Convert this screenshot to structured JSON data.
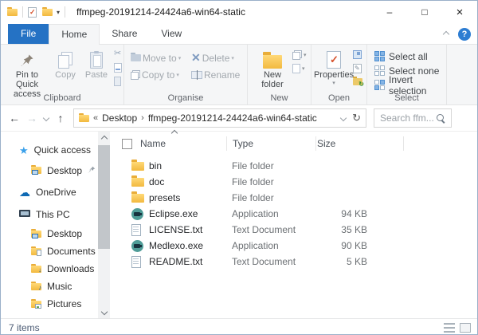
{
  "window": {
    "title": "ffmpeg-20191214-24424a6-win64-static",
    "minimize_glyph": "–",
    "maximize_glyph": "□",
    "close_glyph": "×"
  },
  "ribbon": {
    "tabs": [
      {
        "label": "File"
      },
      {
        "label": "Home"
      },
      {
        "label": "Share"
      },
      {
        "label": "View"
      }
    ],
    "active_tab": "Home",
    "help_label": "?",
    "clipboard": {
      "label": "Clipboard",
      "pin": "Pin to Quick access",
      "copy": "Copy",
      "paste": "Paste"
    },
    "organise": {
      "label": "Organise",
      "move_to": "Move to",
      "delete": "Delete",
      "copy_to": "Copy to",
      "rename": "Rename"
    },
    "new_group": {
      "label": "New",
      "new_folder": "New folder"
    },
    "open_group": {
      "label": "Open",
      "properties": "Properties"
    },
    "select_group": {
      "label": "Select",
      "select_all": "Select all",
      "select_none": "Select none",
      "invert": "Invert selection"
    }
  },
  "address_bar": {
    "breadcrumb_collapse": "«",
    "separator": "›",
    "crumbs": [
      {
        "label": "Desktop"
      },
      {
        "label": "ffmpeg-20191214-24424a6-win64-static"
      }
    ],
    "search_placeholder": "Search ffm..."
  },
  "sidebar": {
    "items": [
      {
        "label": "Quick access",
        "icon": "star-icon"
      },
      {
        "label": "Desktop",
        "icon": "desktop-folder-icon",
        "pinned": true
      },
      {
        "label": "OneDrive",
        "icon": "cloud-icon"
      },
      {
        "label": "This PC",
        "icon": "pc-icon"
      },
      {
        "label": "Desktop",
        "icon": "desktop-folder-icon"
      },
      {
        "label": "Documents",
        "icon": "documents-folder-icon"
      },
      {
        "label": "Downloads",
        "icon": "downloads-folder-icon"
      },
      {
        "label": "Music",
        "icon": "music-folder-icon"
      },
      {
        "label": "Pictures",
        "icon": "pictures-folder-icon"
      }
    ],
    "cloud_glyph": "☁",
    "star_glyph": "★",
    "downloads_glyph": "↓",
    "music_glyph": "♪"
  },
  "file_list": {
    "columns": [
      {
        "label": "Name"
      },
      {
        "label": "Type"
      },
      {
        "label": "Size"
      }
    ],
    "rows": [
      {
        "name": "bin",
        "type": "File folder",
        "size": "",
        "icon": "folder-icon"
      },
      {
        "name": "doc",
        "type": "File folder",
        "size": "",
        "icon": "folder-icon"
      },
      {
        "name": "presets",
        "type": "File folder",
        "size": "",
        "icon": "folder-icon"
      },
      {
        "name": "Eclipse.exe",
        "type": "Application",
        "size": "94 KB",
        "icon": "application-icon"
      },
      {
        "name": "LICENSE.txt",
        "type": "Text Document",
        "size": "35 KB",
        "icon": "text-file-icon"
      },
      {
        "name": "Medlexo.exe",
        "type": "Application",
        "size": "90 KB",
        "icon": "application-icon"
      },
      {
        "name": "README.txt",
        "type": "Text Document",
        "size": "5 KB",
        "icon": "text-file-icon"
      }
    ]
  },
  "status_bar": {
    "items_count": "7 items"
  },
  "icons_legend": {
    "refresh": "↻",
    "back_arrow": "←",
    "forward_arrow": "→",
    "up_arrow": "↑",
    "cut": "✂",
    "properties_check": "✓"
  },
  "colors": {
    "file_tab_blue": "#2572c4",
    "help_blue": "#2d7dd2",
    "folder_yellow": "#f2b93f",
    "exe_teal": "#4f9c97",
    "ribbon_bg": "#f5f6f7"
  }
}
